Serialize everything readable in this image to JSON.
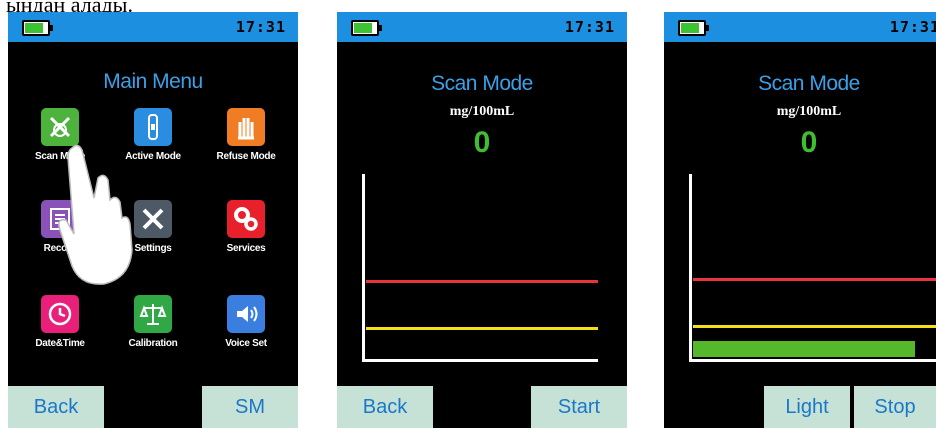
{
  "caption": "ындан алады.",
  "status": {
    "time": "17:31"
  },
  "screen1": {
    "title": "Main Menu",
    "items": [
      {
        "label": "Scan Mode",
        "icon": "scan-icon",
        "color": "#4db33d"
      },
      {
        "label": "Active Mode",
        "icon": "breathalyzer-icon",
        "color": "#2a8de0"
      },
      {
        "label": "Refuse Mode",
        "icon": "refuse-hand-icon",
        "color": "#f07c24"
      },
      {
        "label": "Record",
        "icon": "record-icon",
        "color": "#8a52b8"
      },
      {
        "label": "Settings",
        "icon": "tools-icon",
        "color": "#4d5a66"
      },
      {
        "label": "Services",
        "icon": "gears-icon",
        "color": "#e8202c"
      },
      {
        "label": "Date&Time",
        "icon": "clock-icon",
        "color": "#e8207a"
      },
      {
        "label": "Calibration",
        "icon": "scale-icon",
        "color": "#2fa845"
      },
      {
        "label": "Voice Set",
        "icon": "speaker-icon",
        "color": "#3a7fe0"
      }
    ],
    "buttons": {
      "left": "Back",
      "right": "SM"
    }
  },
  "screen2": {
    "title": "Scan Mode",
    "unit": "mg/100mL",
    "reading": "0",
    "buttons": {
      "left": "Back",
      "right": "Start"
    }
  },
  "screen3": {
    "title": "Scan Mode",
    "unit": "mg/100mL",
    "reading": "0",
    "buttons": {
      "left": "Light",
      "right": "Stop"
    }
  }
}
